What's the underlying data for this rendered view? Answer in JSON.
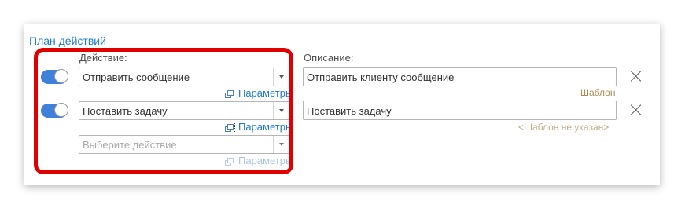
{
  "section": {
    "title": "План действий"
  },
  "labels": {
    "action": "Действие:",
    "description": "Описание:"
  },
  "rows": [
    {
      "enabled": true,
      "action": "Отправить сообщение",
      "params_link": "Параметры",
      "description": "Отправить клиенту сообщение",
      "template_link": "Шаблон"
    },
    {
      "enabled": true,
      "action": "Поставить задачу",
      "params_link": "Параметры",
      "description": "Поставить задачу",
      "template_link": "<Шаблон не указан>"
    }
  ],
  "new_action": {
    "placeholder": "Выберите действие",
    "params_link": "Параметры"
  },
  "colors": {
    "accent": "#1e7bd2",
    "toggle_on": "#3f80d8",
    "highlight_frame": "#e00000",
    "template_link": "#b08b52"
  },
  "icons": {
    "toggle": "toggle-switch-icon",
    "dropdown": "chevron-down-icon",
    "params": "open-window-icon",
    "remove": "close-icon"
  }
}
